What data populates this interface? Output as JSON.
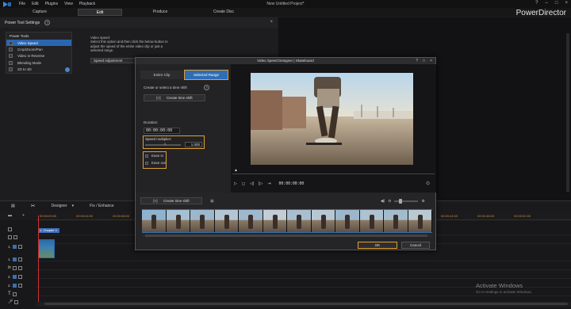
{
  "app": {
    "menu": [
      "File",
      "Edit",
      "Plugins",
      "View",
      "Playback"
    ],
    "project_title": "New Untitled Project*",
    "brand": "PowerDirector",
    "modes": [
      "Capture",
      "Edit",
      "Produce",
      "Create Disc"
    ],
    "active_mode": "Edit"
  },
  "power_tools": {
    "panel_title": "Power Tool Settings",
    "box_title": "Power Tools",
    "items": [
      "Video Speed",
      "Crop/Zoom/Pan",
      "Video in Reverse",
      "Blending Mode",
      "2D to 3D"
    ],
    "active_item": "Video Speed",
    "description": "Video speed:\nSelect this option and then click the below button to adjust the speed of the entire video clip or just a selected range.",
    "button_label": "Speed Adjustment"
  },
  "dialog": {
    "title": "Video Speed Designer  |  Skateboard",
    "tabs": [
      "Entire Clip",
      "Selected Range"
    ],
    "active_tab": "Selected Range",
    "select_label": "Create or select a time shift",
    "create_shift_label": "Create time shift",
    "duration_label": "Duration:",
    "duration_value": "00:00:00:00",
    "speed_label": "Speed multiplier:",
    "speed_slider_mark": "0",
    "speed_value": "1.000",
    "ease_in": "Ease in",
    "ease_out": "Ease out",
    "timecode": "00:00:00:00",
    "strip_create_label": "Create time shift",
    "ok": "OK",
    "cancel": "Cancel"
  },
  "timeline": {
    "toolbar": [
      "Designer",
      "Fix / Enhance"
    ],
    "ruler_labels": [
      "00:00:00:00",
      "00:00:04:00",
      "00:00:08:00",
      "00:00:12:00",
      "00:00:16:00",
      "00:00:20:00",
      "00:00:24:00",
      "00:00:28:00",
      "00:00:32:00",
      "00:00:36:00",
      "00:00:40:00",
      "00:00:44:00",
      "00:00:48:00",
      "00:00:52:00"
    ],
    "chapter_label": "1. Chapter 1",
    "track_labels": [
      "1.",
      "1.",
      "2.",
      "2."
    ]
  },
  "watermark": {
    "title": "Activate Windows",
    "subtitle": "Go to Settings to activate Windows."
  },
  "colors": {
    "accent": "#2f6db5",
    "highlight": "#e0a030"
  }
}
